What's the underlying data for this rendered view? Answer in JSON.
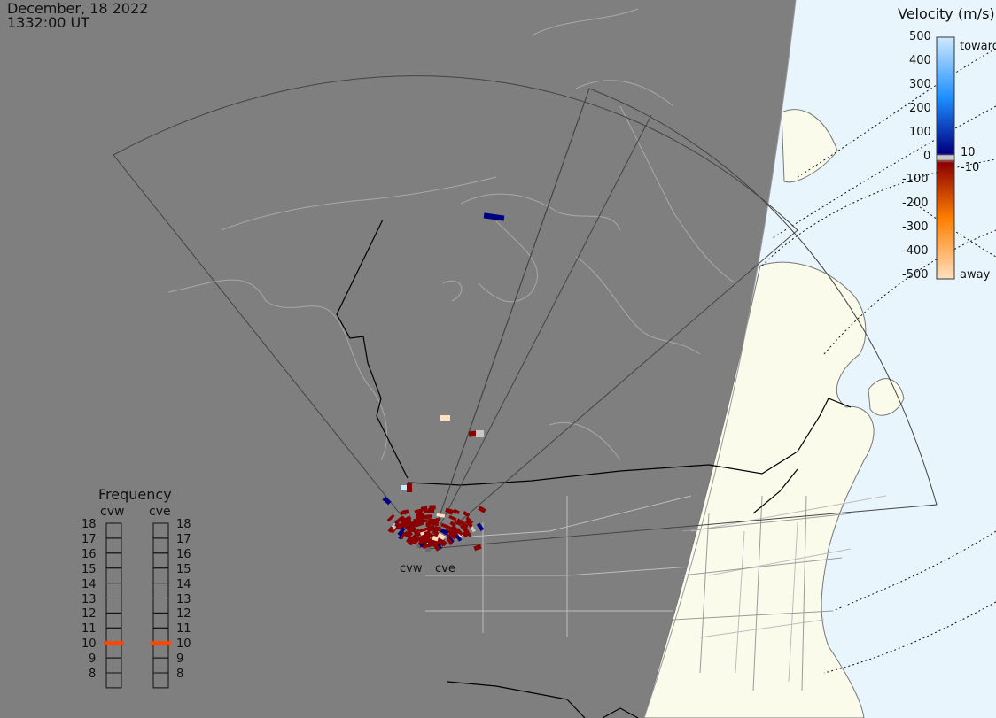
{
  "header": {
    "date": "December, 18 2022",
    "time": "1332:00 UT"
  },
  "colorbar": {
    "title": "Velocity (m/s)",
    "tick_labels": [
      "500",
      "400",
      "300",
      "200",
      "100",
      "0",
      "-100",
      "-200",
      "-300",
      "-400",
      "-500"
    ],
    "label_toward": "toward",
    "label_away": "away",
    "label_plus10": "10",
    "label_minus10": "-10",
    "colors": {
      "toward_light": "#cfe9ff",
      "toward_mid": "#1e8fff",
      "toward_dark": "#000080",
      "away_dark": "#8b0000",
      "away_mid": "#ff7f00",
      "away_light": "#ffe0c0",
      "zero_band": "#c8c8c8"
    }
  },
  "frequency": {
    "title": "Frequency",
    "columns": [
      {
        "name": "cvw",
        "selected": 11
      },
      {
        "name": "cve",
        "selected": 11
      }
    ],
    "levels": [
      "18",
      "17",
      "16",
      "15",
      "14",
      "13",
      "12",
      "11",
      "10",
      "9",
      "8"
    ],
    "marker_color": "#ff4500"
  },
  "radars": {
    "sites": [
      "cvw",
      "cve"
    ]
  },
  "colors": {
    "night": "#7f7f7f",
    "land_day": "#fbfbec",
    "ocean_day": "#e8f5fd"
  }
}
